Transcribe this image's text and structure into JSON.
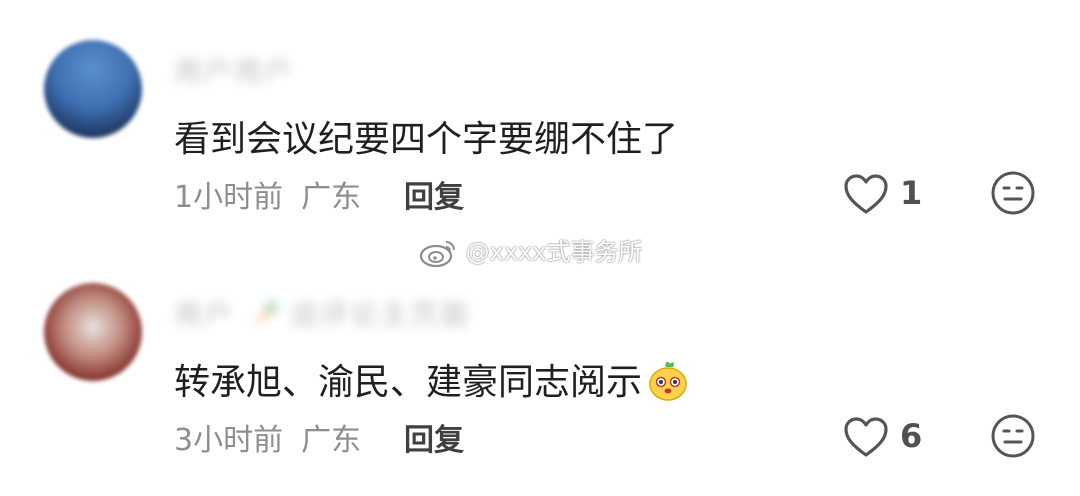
{
  "watermark": {
    "icon": "weibo-logo-icon",
    "text": "@xxxx式事务所"
  },
  "comments": [
    {
      "username": "用户用户",
      "text": "看到会议纪要四个字要绷不住了",
      "time": "1小时前",
      "location": "广东",
      "reply_label": "回复",
      "likes": "1",
      "avatar_color": "#3f70b2"
    },
    {
      "username": "用户",
      "username_suffix": "追评论主页面",
      "text": "转承旭、渝民、建豪同志阅示",
      "time": "3小时前",
      "location": "广东",
      "reply_label": "回复",
      "likes": "6",
      "avatar_color": "#8c3c34"
    }
  ],
  "icons": {
    "like": "heart-outline-icon",
    "reaction": "neutral-face-icon",
    "emoji": "mango-emoji-icon",
    "carrot": "carrot-icon"
  },
  "colors": {
    "text": "#1f1f1f",
    "meta": "#8e8e8e",
    "reply": "#404040"
  }
}
